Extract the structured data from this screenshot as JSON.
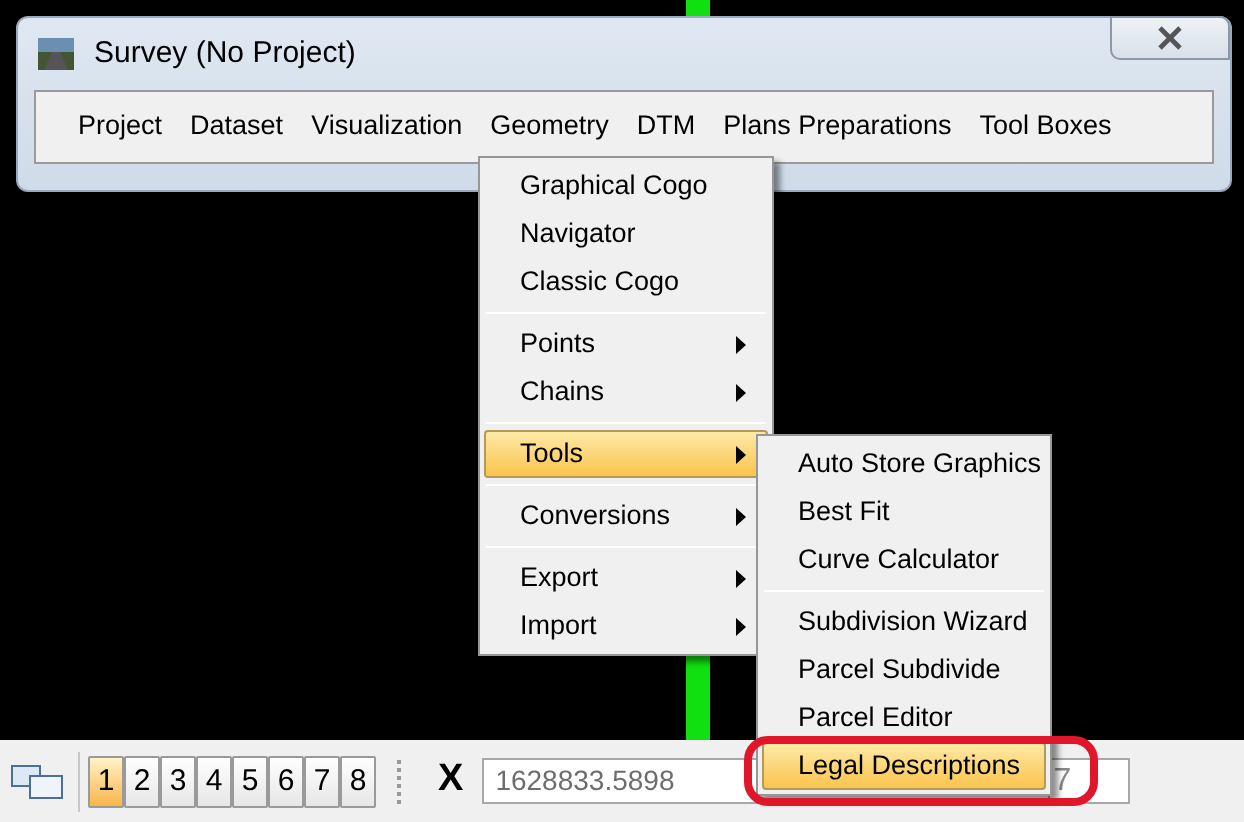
{
  "window": {
    "title": "Survey (No Project)"
  },
  "menu_bar": [
    {
      "label": "Project"
    },
    {
      "label": "Dataset"
    },
    {
      "label": "Visualization"
    },
    {
      "label": "Geometry"
    },
    {
      "label": "DTM"
    },
    {
      "label": "Plans Preparations"
    },
    {
      "label": "Tool Boxes"
    }
  ],
  "geometry_menu": [
    [
      {
        "label": "Graphical Cogo",
        "submenu": false,
        "selected": false
      },
      {
        "label": "Navigator",
        "submenu": false,
        "selected": false
      },
      {
        "label": "Classic Cogo",
        "submenu": false,
        "selected": false
      }
    ],
    [
      {
        "label": "Points",
        "submenu": true,
        "selected": false
      },
      {
        "label": "Chains",
        "submenu": true,
        "selected": false
      }
    ],
    [
      {
        "label": "Tools",
        "submenu": true,
        "selected": true
      }
    ],
    [
      {
        "label": "Conversions",
        "submenu": true,
        "selected": false
      }
    ],
    [
      {
        "label": "Export",
        "submenu": true,
        "selected": false
      },
      {
        "label": "Import",
        "submenu": true,
        "selected": false
      }
    ]
  ],
  "tools_submenu": [
    [
      {
        "label": "Auto Store Graphics",
        "selected": false,
        "annotated": false
      },
      {
        "label": "Best Fit",
        "selected": false,
        "annotated": false
      },
      {
        "label": "Curve Calculator",
        "selected": false,
        "annotated": false
      }
    ],
    [
      {
        "label": "Subdivision Wizard",
        "selected": false,
        "annotated": false
      },
      {
        "label": "Parcel Subdivide",
        "selected": false,
        "annotated": false
      },
      {
        "label": "Parcel Editor",
        "selected": false,
        "annotated": false
      },
      {
        "label": "Legal Descriptions",
        "selected": true,
        "annotated": true
      }
    ]
  ],
  "toolbar": {
    "views": [
      {
        "label": "1",
        "selected": true
      },
      {
        "label": "2",
        "selected": false
      },
      {
        "label": "3",
        "selected": false
      },
      {
        "label": "4",
        "selected": false
      },
      {
        "label": "5",
        "selected": false
      },
      {
        "label": "6",
        "selected": false
      },
      {
        "label": "7",
        "selected": false
      },
      {
        "label": "8",
        "selected": false
      }
    ],
    "x_label": "X",
    "x_value": "1628833.5898",
    "next_field_value": "7"
  }
}
